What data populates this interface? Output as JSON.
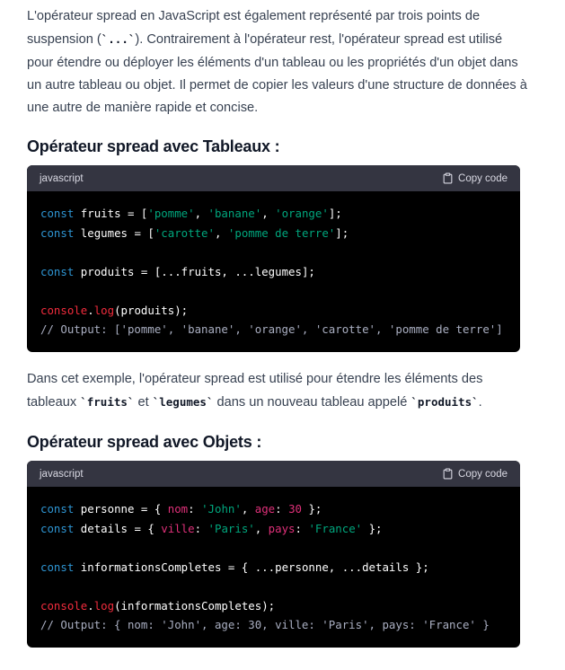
{
  "intro": {
    "line1": "L'opérateur spread en JavaScript est également représenté par trois points de",
    "line2_a": "suspension (",
    "line2_code": "`...`",
    "line2_b": "). Contrairement à l'opérateur rest, l'opérateur spread est utilisé",
    "line3": "pour étendre ou déployer les éléments d'un tableau ou les propriétés d'un objet dans",
    "line4": "un autre tableau ou objet. Il permet de copier les valeurs d'une structure de données à",
    "line5": "une autre de manière rapide et concise."
  },
  "section1": {
    "heading": "Opérateur spread avec Tableaux :",
    "language": "javascript",
    "copy_label": "Copy code",
    "code": {
      "l1": {
        "kw": "const",
        "a": " fruits = [",
        "s1": "'pomme'",
        "c1": ", ",
        "s2": "'banane'",
        "c2": ", ",
        "s3": "'orange'",
        "end": "];"
      },
      "l2": {
        "kw": "const",
        "a": " legumes = [",
        "s1": "'carotte'",
        "c1": ", ",
        "s2": "'pomme de terre'",
        "end": "];"
      },
      "l3": {
        "kw": "const",
        "a": " produits = [...fruits, ...legumes];"
      },
      "l4": {
        "obj": "console",
        "dot": ".",
        "method": "log",
        "rest": "(produits);"
      },
      "l5": "// Output: ['pomme', 'banane', 'orange', 'carotte', 'pomme de terre']"
    }
  },
  "middle": {
    "line1": "Dans cet exemple, l'opérateur spread est utilisé pour étendre les éléments des",
    "line2_a": "tableaux ",
    "code1": "`fruits`",
    "line2_b": " et ",
    "code2": "`legumes`",
    "line2_c": " dans un nouveau tableau appelé ",
    "code3": "`produits`",
    "line2_d": "."
  },
  "section2": {
    "heading": "Opérateur spread avec Objets :",
    "language": "javascript",
    "copy_label": "Copy code",
    "code": {
      "l1": {
        "kw": "const",
        "a": " personne = { ",
        "p1": "nom",
        "b": ": ",
        "s1": "'John'",
        "c": ", ",
        "p2": "age",
        "d": ": ",
        "n1": "30",
        "end": " };"
      },
      "l2": {
        "kw": "const",
        "a": " details = { ",
        "p1": "ville",
        "b": ": ",
        "s1": "'Paris'",
        "c": ", ",
        "p2": "pays",
        "d": ": ",
        "s2": "'France'",
        "end": " };"
      },
      "l3": {
        "kw": "const",
        "a": " informationsCompletes = { ...personne, ...details };"
      },
      "l4": {
        "obj": "console",
        "dot": ".",
        "method": "log",
        "rest": "(informationsCompletes);"
      },
      "l5": "// Output: { nom: 'John', age: 30, ville: 'Paris', pays: 'France' }"
    }
  }
}
